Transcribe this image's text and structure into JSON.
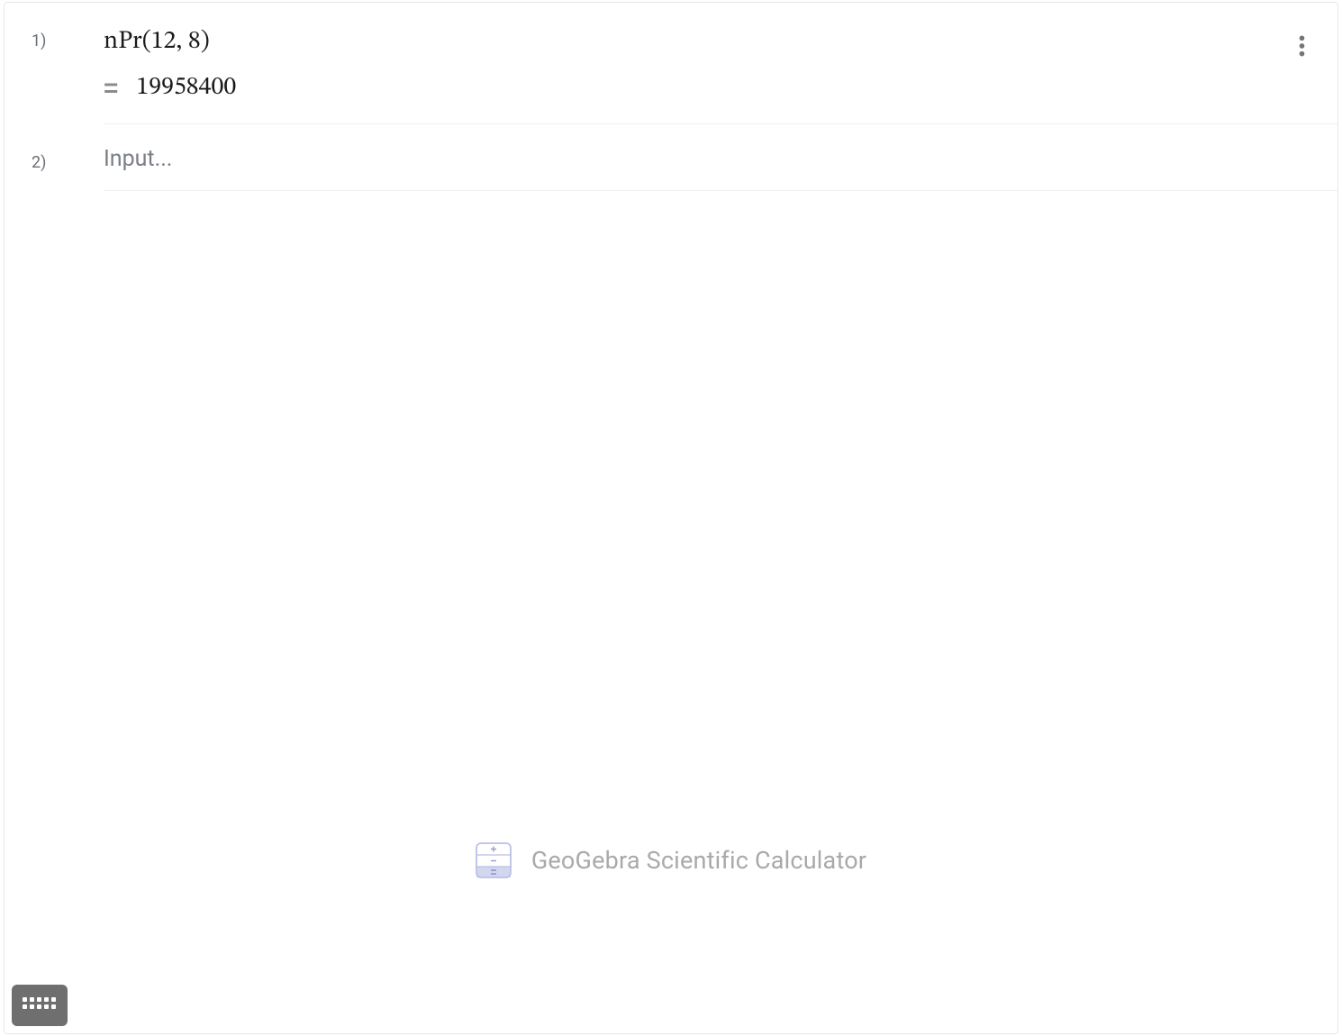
{
  "rows": [
    {
      "index": "1)",
      "expression": "nPr(12, 8)",
      "equals": "=",
      "result": "19958400"
    },
    {
      "index": "2)",
      "placeholder": "Input..."
    }
  ],
  "watermark": {
    "text": "GeoGebra Scientific Calculator"
  }
}
